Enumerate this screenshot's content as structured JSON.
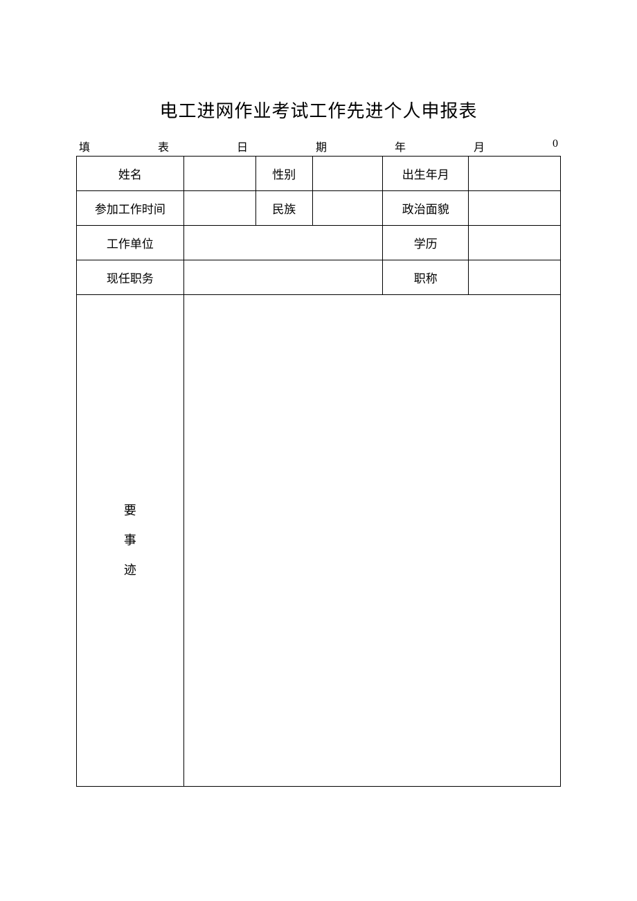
{
  "title": "电工进网作业考试工作先进个人申报表",
  "dateLine": {
    "c1": "填",
    "c2": "表",
    "c3": "日",
    "c4": "期",
    "c5": "年",
    "c6": "月",
    "c7": "0"
  },
  "labels": {
    "name": "姓名",
    "gender": "性别",
    "birth": "出生年月",
    "workStart": "参加工作时间",
    "ethnicity": "民族",
    "political": "政治面貌",
    "workUnit": "工作单位",
    "education": "学历",
    "position": "现任职务",
    "jobTitle": "职称"
  },
  "deeds": {
    "v1": "要",
    "v2": "事",
    "v3": "迹"
  },
  "values": {
    "name": "",
    "gender": "",
    "birth": "",
    "workStart": "",
    "ethnicity": "",
    "political": "",
    "workUnit": "",
    "education": "",
    "position": "",
    "jobTitle": "",
    "deedsContent": ""
  }
}
